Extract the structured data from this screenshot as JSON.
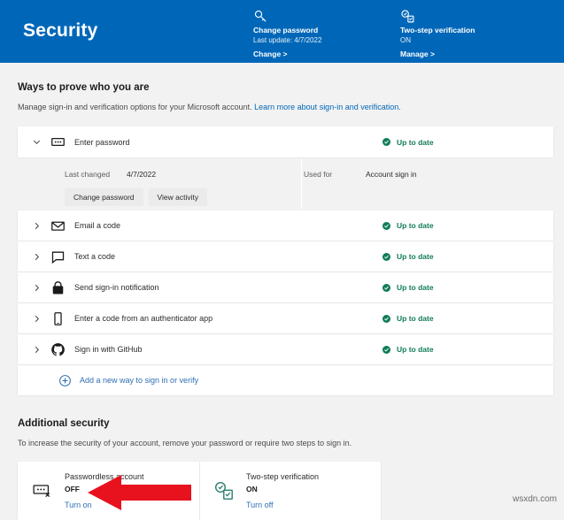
{
  "header": {
    "title": "Security",
    "background_color": "#0067b8",
    "tiles": [
      {
        "icon": "key-icon",
        "name": "Change password",
        "sub": "Last update: 4/7/2022",
        "link": "Change >"
      },
      {
        "icon": "two-step-verification-icon",
        "name": "Two-step verification",
        "sub": "ON",
        "link": "Manage >"
      }
    ]
  },
  "ways_section": {
    "title": "Ways to prove who you are",
    "desc_text": "Manage sign-in and verification options for your Microsoft account. ",
    "desc_link": "Learn more about sign-in and verification."
  },
  "signin_rows": [
    {
      "icon": "password-dots-icon",
      "label": "Enter password",
      "status": "Up to date",
      "chevron": "chevron-down",
      "expanded": true
    },
    {
      "icon": "envelope-icon",
      "label": "Email a code",
      "status": "Up to date",
      "chevron": "chevron-right",
      "expanded": false
    },
    {
      "icon": "chat-bubble-icon",
      "label": "Text a code",
      "status": "Up to date",
      "chevron": "chevron-right",
      "expanded": false
    },
    {
      "icon": "lock-icon",
      "label": "Send sign-in notification",
      "status": "Up to date",
      "chevron": "chevron-right",
      "expanded": false
    },
    {
      "icon": "phone-icon",
      "label": "Enter a code from an authenticator app",
      "status": "Up to date",
      "chevron": "chevron-right",
      "expanded": false
    },
    {
      "icon": "github-icon",
      "label": "Sign in with GitHub",
      "status": "Up to date",
      "chevron": "chevron-right",
      "expanded": false
    }
  ],
  "password_detail": {
    "last_changed_key": "Last changed",
    "last_changed_value": "4/7/2022",
    "used_for_key": "Used for",
    "used_for_value": "Account sign in",
    "change_password_button": "Change password",
    "view_activity_button": "View activity"
  },
  "add_method": {
    "icon": "plus-circle-icon",
    "label": "Add a new way to sign in or verify"
  },
  "additional_section": {
    "title": "Additional security",
    "desc": "To increase the security of your account, remove your password or require two steps to sign in."
  },
  "additional_tiles": [
    {
      "icon": "passwordless-icon",
      "name": "Passwordless account",
      "state": "OFF",
      "action": "Turn on"
    },
    {
      "icon": "two-step-verification-icon",
      "name": "Two-step verification",
      "state": "ON",
      "action": "Turn off"
    }
  ],
  "annotation": {
    "arrow_color": "#e8121e",
    "arrow_direction": "left",
    "points_at": "Turn on"
  },
  "watermark": "wsxdn.com",
  "colors": {
    "brand_blue": "#0067b8",
    "link_blue": "#2f6fb5",
    "status_green": "#107c5a",
    "page_bg": "#f2f2f2",
    "card_bg": "#ffffff",
    "teal_icon": "#2e7d6f"
  }
}
